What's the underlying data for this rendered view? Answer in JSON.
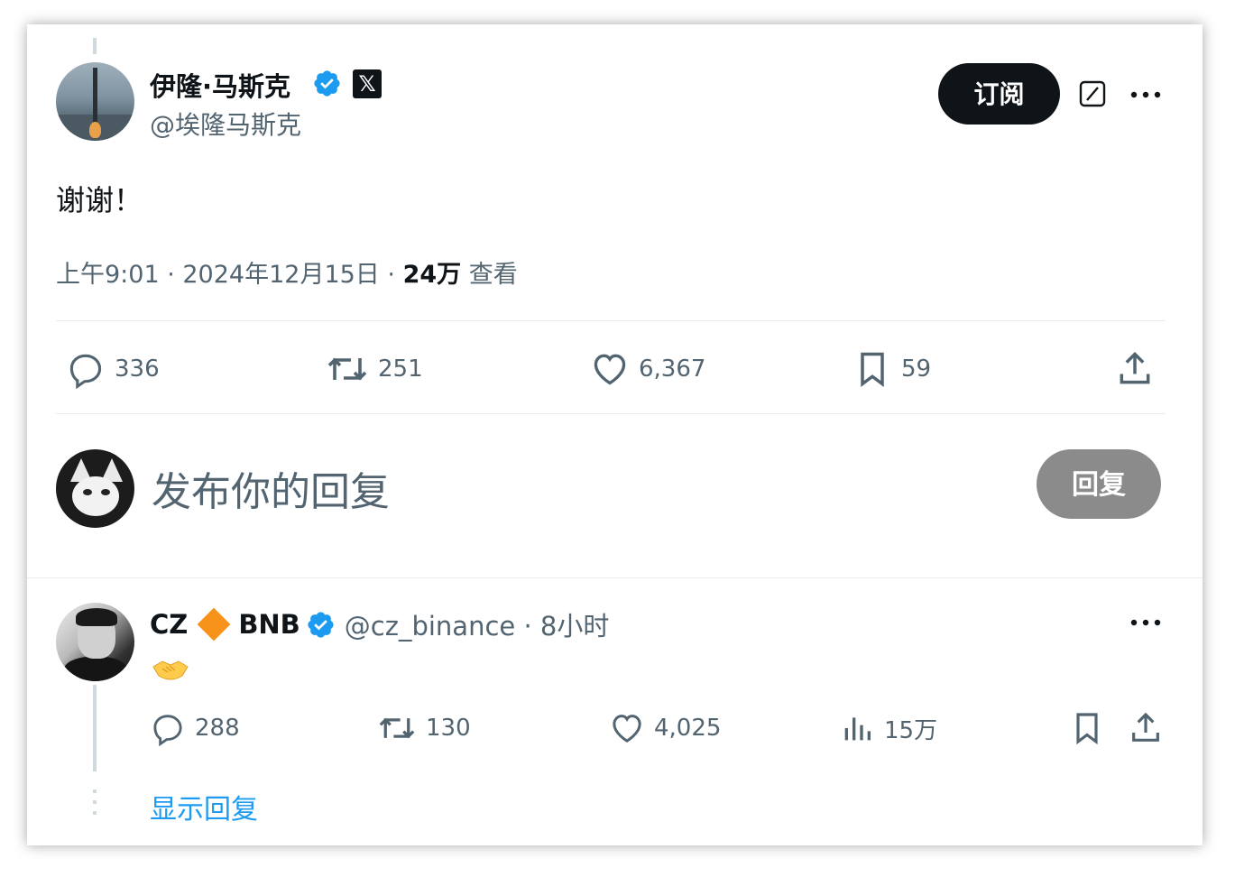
{
  "main_tweet": {
    "author_name": "伊隆·马斯克",
    "x_badge": "𝕏",
    "handle": "@埃隆马斯克",
    "subscribe_label": "订阅",
    "text": "谢谢！",
    "time": "上午9:01 · 2024年12月15日 · ",
    "views_count": "24万",
    "views_label": " 查看",
    "actions": {
      "replies": "336",
      "retweets": "251",
      "likes": "6,367",
      "bookmarks": "59"
    },
    "icons": [
      "verified-icon",
      "x-badge-icon",
      "grok-icon",
      "more-icon",
      "reply-icon",
      "retweet-icon",
      "like-icon",
      "bookmark-icon",
      "share-icon"
    ]
  },
  "compose": {
    "placeholder": "发布你的回复",
    "reply_button": "回复"
  },
  "reply_tweet": {
    "name": "CZ",
    "name_suffix": "BNB",
    "handle_time": "@cz_binance · 8小时",
    "emoji": "handshake-emoji",
    "actions": {
      "replies": "288",
      "retweets": "130",
      "likes": "4,025",
      "views": "15万"
    },
    "show_replies": "显示回复"
  },
  "colors": {
    "text": "#0f1419",
    "muted": "#536471",
    "link": "#1d9bf0",
    "verified": "#1d9bf0",
    "bnb": "#f7931a",
    "reply_button_disabled": "#8b8b8b"
  }
}
